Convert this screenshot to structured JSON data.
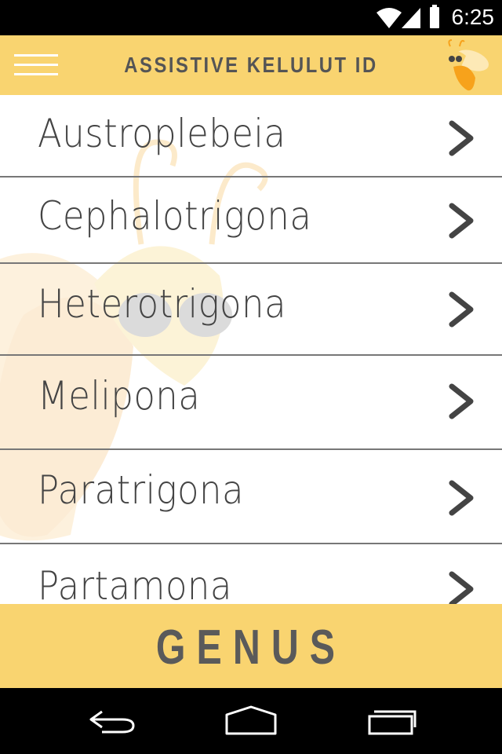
{
  "status_bar": {
    "time": "6:25",
    "icons": [
      "wifi-icon",
      "signal-icon",
      "battery-icon"
    ]
  },
  "header": {
    "title": "ASSISTIVE KELULUT ID",
    "menu_icon": "hamburger-menu-icon",
    "logo_icon": "bee-logo-icon"
  },
  "genus_list": {
    "items": [
      {
        "label": "Austroplebeia"
      },
      {
        "label": "Cephalotrigona"
      },
      {
        "label": "Heterotrigona"
      },
      {
        "label": "Melipona"
      },
      {
        "label": "Paratrigona"
      },
      {
        "label": "Partamona"
      }
    ],
    "chevron_icon": "chevron-right-icon"
  },
  "footer": {
    "section_label": "GENUS"
  },
  "nav_bar": {
    "items": [
      "back-icon",
      "home-icon",
      "recent-apps-icon"
    ]
  },
  "colors": {
    "accent": "#f9d470",
    "text": "#444444",
    "divider": "#777777",
    "bee_orange": "#f7a21b"
  }
}
